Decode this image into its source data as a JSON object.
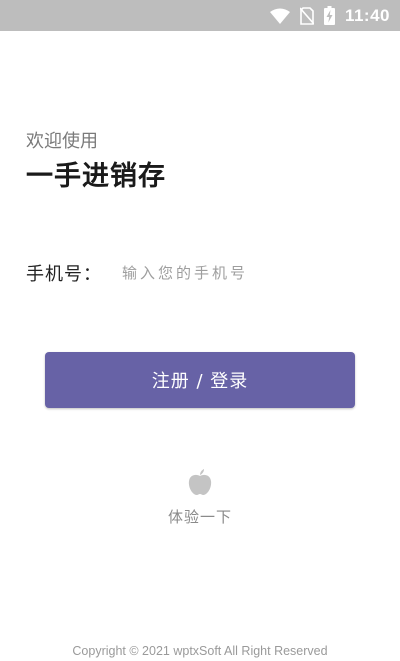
{
  "status_bar": {
    "time": "11:40",
    "icons": [
      "wifi-icon",
      "no-sim-icon",
      "battery-charging-icon"
    ]
  },
  "header": {
    "welcome": "欢迎使用",
    "app_name": "一手进销存"
  },
  "form": {
    "phone_label": "手机号：",
    "phone_placeholder": "输入您的手机号",
    "phone_value": ""
  },
  "actions": {
    "login_button_label": "注册 / 登录",
    "trial_icon": "apple-icon",
    "trial_label": "体验一下"
  },
  "footer": {
    "copyright": "Copyright © 2021 wptxSoft All Right Reserved"
  },
  "colors": {
    "primary": "#6762a6",
    "status_bar": "#bdbdbd",
    "muted_text": "#9e9e9e"
  }
}
